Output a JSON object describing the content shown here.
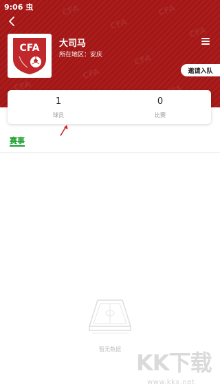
{
  "status_bar": {
    "time": "9:06",
    "notification_glyph": "虫"
  },
  "header": {
    "back_icon": "chevron-left-icon",
    "logo_text": "CFA",
    "team_name": "大司马",
    "region_label": "所在地区：",
    "region_value": "安庆",
    "menu_icon": "hamburger-menu-icon",
    "invite_button": "邀请入队",
    "background_color": "#a51717"
  },
  "stats": [
    {
      "value": "1",
      "label": "球员"
    },
    {
      "value": "0",
      "label": "比赛"
    }
  ],
  "tabs": [
    {
      "label": "赛事",
      "active": true
    }
  ],
  "accent_color": "#1aa02c",
  "empty_state": {
    "icon": "empty-field-icon",
    "text": "暂无数据"
  },
  "watermark": {
    "brand": "KK下载",
    "url": "www.kkx.net"
  }
}
